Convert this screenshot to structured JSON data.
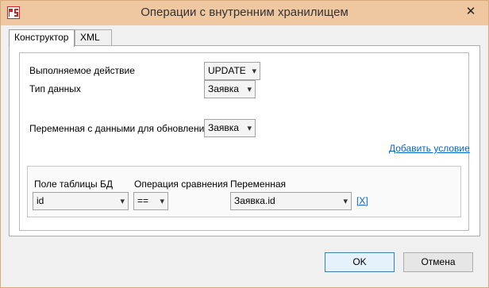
{
  "window": {
    "title": "Операции с внутренним хранилищем",
    "close_glyph": "✕"
  },
  "tabs": [
    {
      "label": "Конструктор",
      "active": true
    },
    {
      "label": "XML",
      "active": false
    }
  ],
  "form": {
    "action_label": "Выполняемое действие",
    "action_value": "UPDATE",
    "datatype_label": "Тип данных",
    "datatype_value": "Заявка",
    "variable_label": "Переменная с данными для обновления",
    "variable_value": "Заявка",
    "add_condition_link": "Добавить условие"
  },
  "conditions": {
    "col_field": "Поле таблицы БД",
    "col_operation": "Операция сравнения",
    "col_variable": "Переменная",
    "rows": [
      {
        "field": "id",
        "operation": "==",
        "variable": "Заявка.id",
        "remove": "[X]"
      }
    ]
  },
  "buttons": {
    "ok": "OK",
    "cancel": "Отмена"
  },
  "colors": {
    "titlebar": "#efc7a0",
    "link": "#0066cc"
  },
  "icons": {
    "app": "app-logo-icon",
    "dropdown": "chevron-down-icon"
  }
}
